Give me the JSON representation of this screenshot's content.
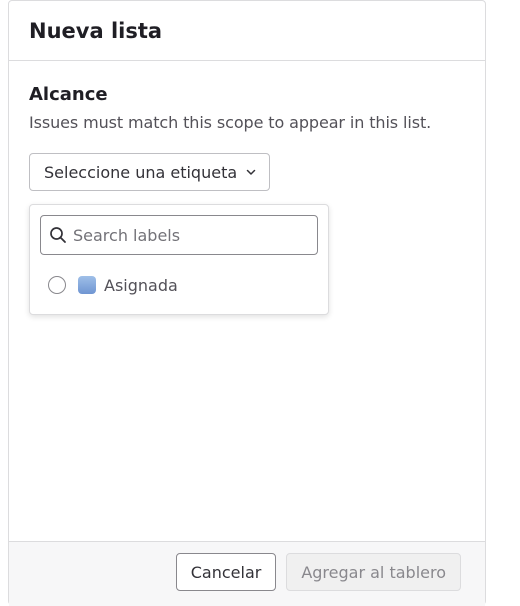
{
  "panel": {
    "title": "Nueva lista"
  },
  "scope": {
    "title": "Alcance",
    "description": "Issues must match this scope to appear in this list."
  },
  "label_select": {
    "value": "Seleccione una etiqueta",
    "icon": "chevron-down-icon"
  },
  "dropdown": {
    "search": {
      "placeholder": "Search labels",
      "value": "",
      "icon": "search-icon"
    },
    "labels": [
      {
        "name": "Asignada",
        "color": "#7fa3dc",
        "selected": false
      }
    ]
  },
  "footer": {
    "cancel_label": "Cancelar",
    "add_label": "Agregar al tablero",
    "add_disabled": true
  },
  "colors": {
    "border": "#dcdcde",
    "footer_bg": "#f7f7f8",
    "text": "#333238"
  }
}
